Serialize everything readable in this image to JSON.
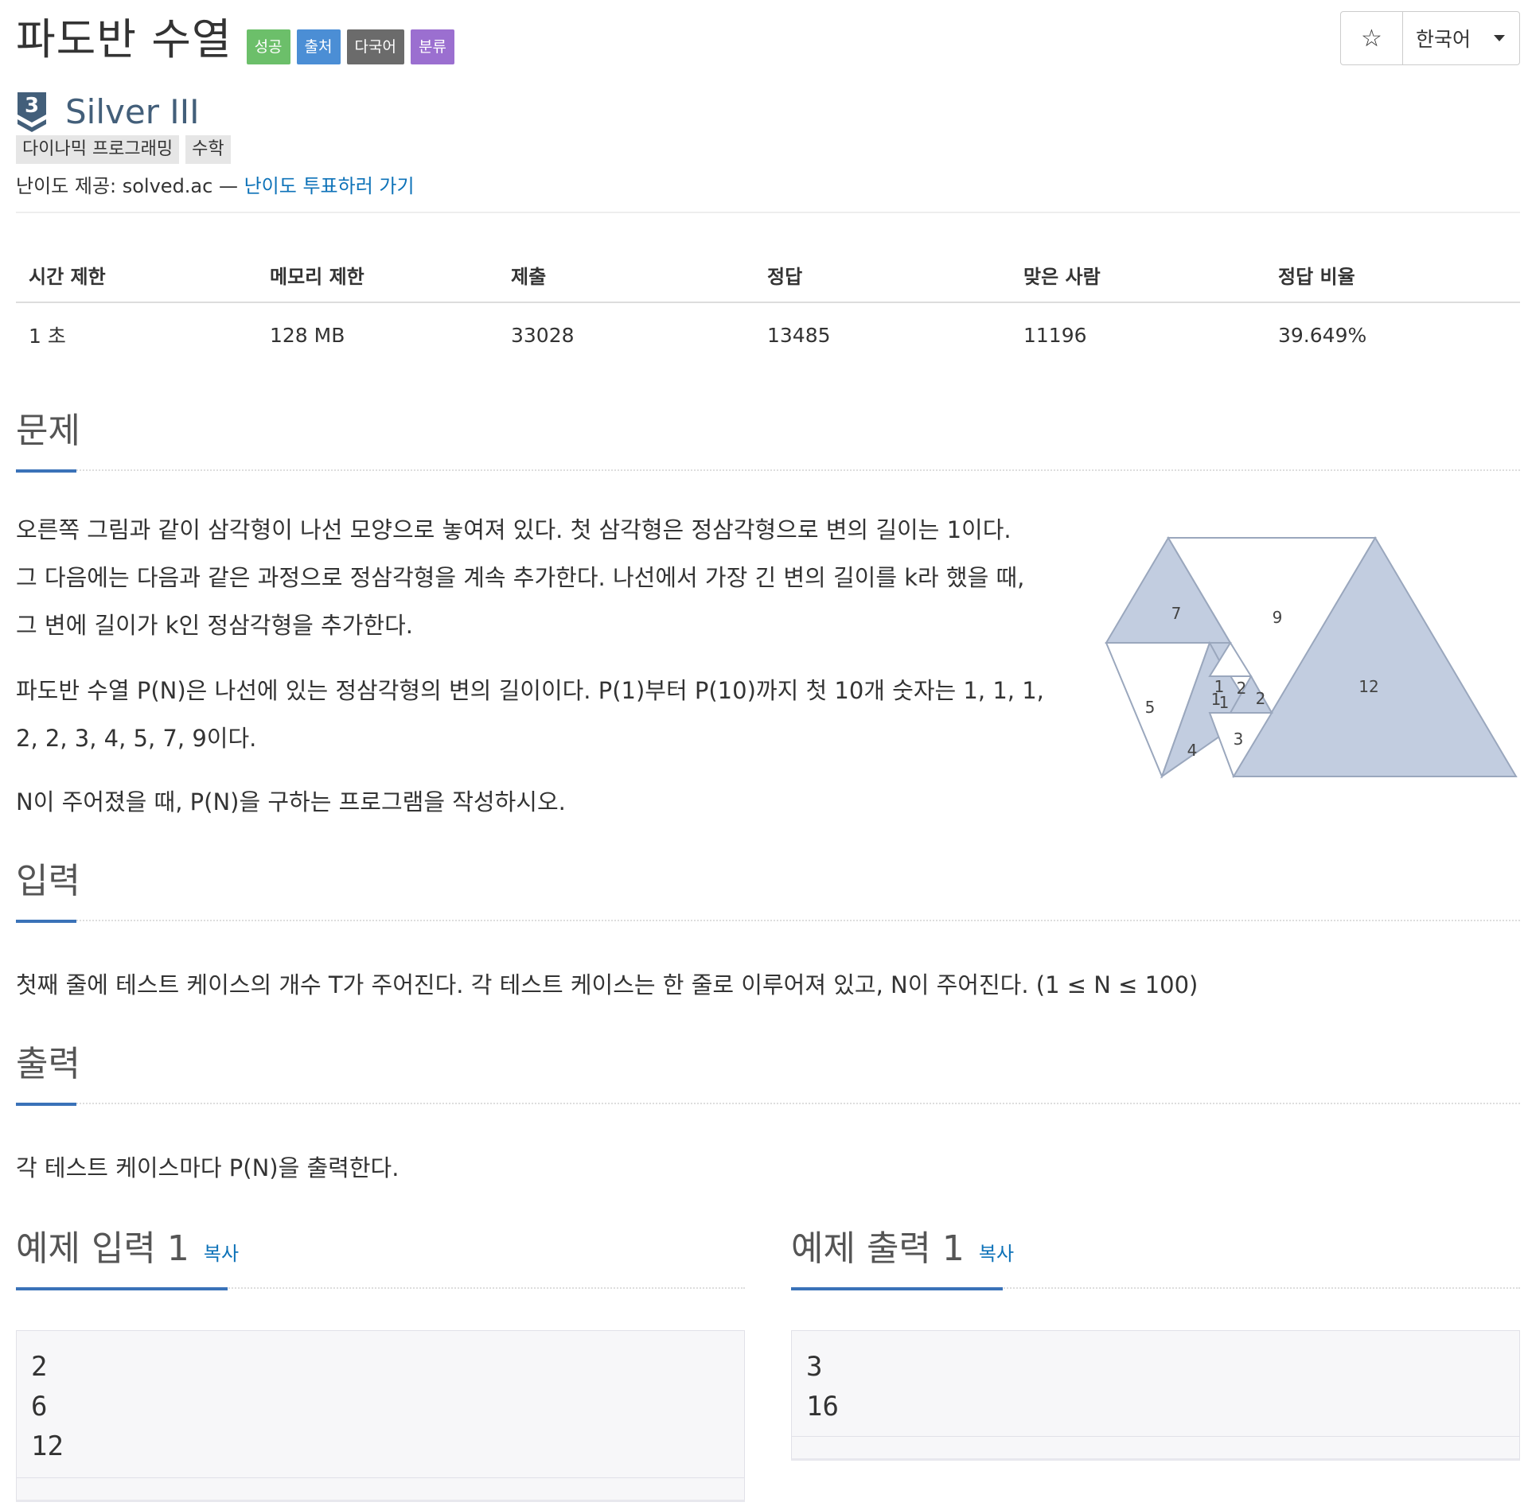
{
  "header": {
    "title": "파도반 수열",
    "badges": [
      {
        "label": "성공",
        "color": "#6cbf6a"
      },
      {
        "label": "출처",
        "color": "#4b8ed5"
      },
      {
        "label": "다국어",
        "color": "#6b6b6b"
      },
      {
        "label": "분류",
        "color": "#9b6fd0"
      }
    ],
    "star_icon": "star-icon",
    "language": "한국어"
  },
  "tier": {
    "icon_number": "3",
    "name": "Silver III"
  },
  "tags": [
    "다이나믹 프로그래밍",
    "수학"
  ],
  "credit": {
    "prefix": "난이도 제공: solved.ac — ",
    "link": "난이도 투표하러 가기"
  },
  "stats": {
    "headers": [
      "시간 제한",
      "메모리 제한",
      "제출",
      "정답",
      "맞은 사람",
      "정답 비율"
    ],
    "values": [
      "1 초",
      "128 MB",
      "33028",
      "13485",
      "11196",
      "39.649%"
    ]
  },
  "problem": {
    "heading": "문제",
    "lines1": [
      "오른쪽 그림과 같이 삼각형이 나선 모양으로 놓여져 있다. 첫 삼각형은 정삼각형으로 변의 길이는 1이다.",
      "그 다음에는 다음과 같은 과정으로 정삼각형을 계속 추가한다. 나선에서 가장 긴 변의 길이를 k라 했을 때,",
      "그 변에 길이가 k인 정삼각형을 추가한다."
    ],
    "lines2": [
      "파도반 수열 P(N)은 나선에 있는 정삼각형의 변의 길이이다. P(1)부터 P(10)까지 첫 10개 숫자는 1, 1, 1,",
      "2, 2, 3, 4, 5, 7, 9이다."
    ],
    "line3": "N이 주어졌을 때, P(N)을 구하는 프로그램을 작성하시오.",
    "figure_labels": [
      "7",
      "9",
      "12",
      "5",
      "1",
      "2",
      "1",
      "1",
      "2",
      "4",
      "3"
    ]
  },
  "input": {
    "heading": "입력",
    "text": "첫째 줄에 테스트 케이스의 개수 T가 주어진다. 각 테스트 케이스는 한 줄로 이루어져 있고, N이 주어진다. (1 ≤ N ≤ 100)"
  },
  "output": {
    "heading": "출력",
    "text": "각 테스트 케이스마다 P(N)을 출력한다."
  },
  "samples": {
    "input_heading": "예제 입력 1",
    "output_heading": "예제 출력 1",
    "copy_label": "복사",
    "input_lines": "2\n6\n12",
    "output_lines": "3\n16"
  }
}
